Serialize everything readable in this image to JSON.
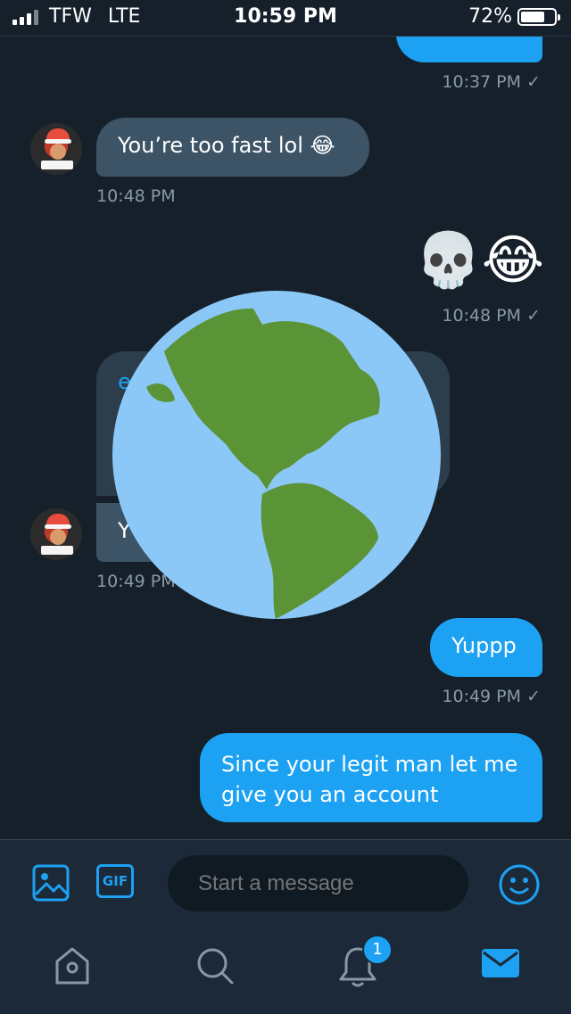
{
  "status_bar": {
    "carrier": "TFW",
    "network": "LTE",
    "time": "10:59 PM",
    "battery": "72%",
    "battery_level": 0.72
  },
  "messages": {
    "m1_time": "10:37 PM ✓",
    "m2_text": "You’re too fast lol 😂",
    "m2_time": "10:48 PM",
    "m3_emoji": "💀😂",
    "m3_time": "10:48 PM ✓",
    "m4_link_fragment": "e",
    "m5_text_fragment": "Y",
    "m5_time": "10:49 PM",
    "m6_text": "Yuppp",
    "m6_time": "10:49 PM ✓",
    "m7_text": "Since your legit man let me give you an account"
  },
  "composer": {
    "gif_label": "GIF",
    "placeholder": "Start a message"
  },
  "tabs": {
    "notifications_badge": "1"
  },
  "icons": [
    "image-icon",
    "gif-icon",
    "emoji-icon",
    "home-icon",
    "search-icon",
    "bell-icon",
    "mail-icon",
    "globe-emoji",
    "skull-emoji",
    "laugh-emoji"
  ],
  "colors": {
    "background": "#15202b",
    "accent": "#1da1f2",
    "incoming_bubble": "#3d5466",
    "bar": "#1c2938"
  }
}
